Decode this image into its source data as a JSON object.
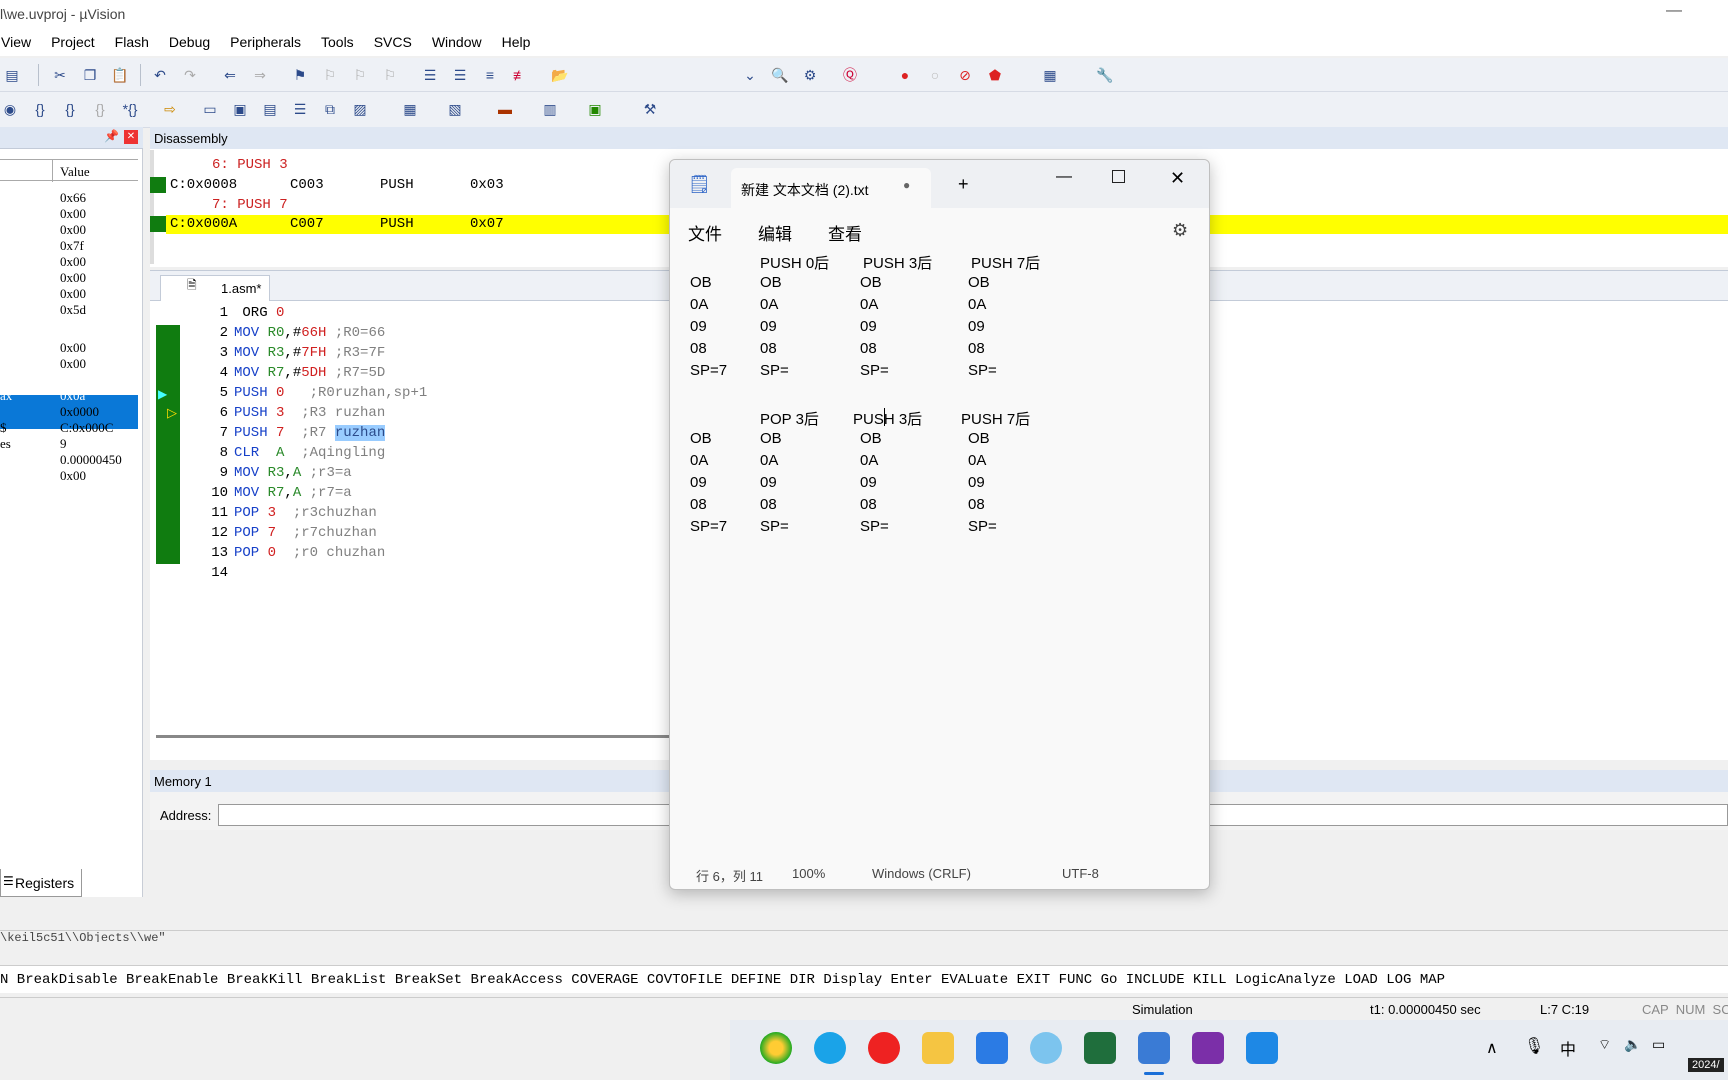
{
  "window": {
    "title": "l\\we.uvproj - µVision",
    "minimize_glyph": "—"
  },
  "menu": [
    "View",
    "Project",
    "Flash",
    "Debug",
    "Peripherals",
    "Tools",
    "SVCS",
    "Window",
    "Help"
  ],
  "registers": {
    "tab_label": "Registers",
    "value_header": "Value",
    "rows": [
      {
        "name": "",
        "value": "0x66"
      },
      {
        "name": "",
        "value": "0x00"
      },
      {
        "name": "",
        "value": "0x00"
      },
      {
        "name": "",
        "value": "0x7f"
      },
      {
        "name": "",
        "value": "0x00"
      },
      {
        "name": "",
        "value": "0x00"
      },
      {
        "name": "",
        "value": "0x00"
      },
      {
        "name": "",
        "value": "0x5d"
      },
      {
        "name": "",
        "value": "0x00"
      },
      {
        "name": "",
        "value": "0x00"
      },
      {
        "name": "",
        "value": "0x0a"
      },
      {
        "name": "ax",
        "value": "0x0a"
      },
      {
        "name": "",
        "value": "0x0000"
      },
      {
        "name": "$",
        "value": "C:0x000C"
      },
      {
        "name": "es",
        "value": "9"
      },
      {
        "name": "",
        "value": "0.00000450"
      },
      {
        "name": "",
        "value": "0x00"
      }
    ]
  },
  "disassembly": {
    "title": "Disassembly",
    "lines": [
      {
        "src": "     6: PUSH 3"
      },
      {
        "addr": "C:0x0008",
        "op": "C003",
        "mn": "PUSH",
        "arg": "0x03"
      },
      {
        "src": "     7: PUSH 7"
      },
      {
        "addr": "C:0x000A",
        "op": "C007",
        "mn": "PUSH",
        "arg": "0x07"
      }
    ]
  },
  "editor": {
    "tab": "1.asm*",
    "lines": [
      {
        "n": "1",
        "parts": [
          [
            "",
            " ORG "
          ],
          [
            "nm",
            "0"
          ]
        ]
      },
      {
        "n": "2",
        "parts": [
          [
            "kw",
            "MOV "
          ],
          [
            "rg",
            "R0"
          ],
          [
            "",
            ",#"
          ],
          [
            "nm",
            "66H"
          ],
          [
            "cm",
            " ;R0=66"
          ]
        ]
      },
      {
        "n": "3",
        "parts": [
          [
            "kw",
            "MOV "
          ],
          [
            "rg",
            "R3"
          ],
          [
            "",
            ",#"
          ],
          [
            "nm",
            "7FH"
          ],
          [
            "cm",
            " ;R3=7F"
          ]
        ]
      },
      {
        "n": "4",
        "parts": [
          [
            "kw",
            "MOV "
          ],
          [
            "rg",
            "R7"
          ],
          [
            "",
            ",#"
          ],
          [
            "nm",
            "5DH"
          ],
          [
            "cm",
            " ;R7=5D"
          ]
        ]
      },
      {
        "n": "5",
        "parts": [
          [
            "kw",
            "PUSH "
          ],
          [
            "nm",
            "0"
          ],
          [
            "cm",
            "   ;R0ruzhan,sp+1"
          ]
        ]
      },
      {
        "n": "6",
        "parts": [
          [
            "kw",
            "PUSH "
          ],
          [
            "nm",
            "3"
          ],
          [
            "cm",
            "  ;R3 ruzhan"
          ]
        ]
      },
      {
        "n": "7",
        "parts": [
          [
            "kw",
            "PUSH "
          ],
          [
            "nm",
            "7"
          ],
          [
            "cm",
            "  ;R7 "
          ],
          [
            "sel",
            "ruzhan"
          ]
        ]
      },
      {
        "n": "8",
        "parts": [
          [
            "kw",
            "CLR  "
          ],
          [
            "rg",
            "A"
          ],
          [
            "cm",
            "  ;Aqingling"
          ]
        ]
      },
      {
        "n": "9",
        "parts": [
          [
            "kw",
            "MOV "
          ],
          [
            "rg",
            "R3"
          ],
          [
            "",
            ","
          ],
          [
            "rg",
            "A"
          ],
          [
            "cm",
            " ;r3=a"
          ]
        ]
      },
      {
        "n": "10",
        "parts": [
          [
            "kw",
            "MOV "
          ],
          [
            "rg",
            "R7"
          ],
          [
            "",
            ","
          ],
          [
            "rg",
            "A"
          ],
          [
            "cm",
            " ;r7=a"
          ]
        ]
      },
      {
        "n": "11",
        "parts": [
          [
            "kw",
            "POP "
          ],
          [
            "nm",
            "3"
          ],
          [
            "cm",
            "  ;r3chuzhan"
          ]
        ]
      },
      {
        "n": "12",
        "parts": [
          [
            "kw",
            "POP "
          ],
          [
            "nm",
            "7"
          ],
          [
            "cm",
            "  ;r7chuzhan"
          ]
        ]
      },
      {
        "n": "13",
        "parts": [
          [
            "kw",
            "POP "
          ],
          [
            "nm",
            "0"
          ],
          [
            "cm",
            "  ;r0 chuzhan"
          ]
        ]
      },
      {
        "n": "14",
        "parts": []
      }
    ]
  },
  "memory": {
    "title": "Memory 1",
    "address_label": "Address:"
  },
  "notepad": {
    "tab_title": "新建 文本文档 (2).txt",
    "new_tab": "+",
    "menu": [
      "文件",
      "编辑",
      "查看"
    ],
    "block1": {
      "headers": [
        "",
        "PUSH 0后",
        "PUSH 3后",
        "PUSH 7后"
      ],
      "rows": [
        [
          "OB",
          "OB",
          "OB",
          "OB"
        ],
        [
          "0A",
          "0A",
          "0A",
          "0A"
        ],
        [
          "09",
          "09",
          "09",
          "09"
        ],
        [
          "08",
          "08",
          "08",
          "08"
        ],
        [
          "SP=7",
          "SP=",
          "SP=",
          "SP="
        ]
      ]
    },
    "block2": {
      "headers": [
        "",
        "POP 3后",
        "PUSH 3后",
        "PUSH 7后"
      ],
      "rows": [
        [
          "OB",
          "OB",
          "OB",
          "OB"
        ],
        [
          "0A",
          "0A",
          "0A",
          "0A"
        ],
        [
          "09",
          "09",
          "09",
          "09"
        ],
        [
          "08",
          "08",
          "08",
          "08"
        ],
        [
          "SP=7",
          "SP=",
          "SP=",
          "SP="
        ]
      ]
    },
    "status": {
      "position": "行 6，列 11",
      "zoom": "100%",
      "eol": "Windows (CRLF)",
      "encoding": "UTF-8"
    }
  },
  "output_path": "\\keil5c51\\\\Objects\\\\we\"",
  "command_bar": "N BreakDisable BreakEnable BreakKill BreakList BreakSet BreakAccess COVERAGE COVTOFILE DEFINE DIR Display Enter EVALuate EXIT FUNC Go INCLUDE KILL LogicAnalyze LOAD LOG MAP",
  "status_bar": {
    "mode": "Simulation",
    "time": "t1: 0.00000450 sec",
    "cursor": "L:7 C:19",
    "caps": "CAP  NUM  SC"
  },
  "taskbar": {
    "ime": "中",
    "clock": "2024/"
  },
  "colors": {
    "highlight_yellow": "#ffff00",
    "selection_blue": "#0a78d7",
    "gutter_green": "#107c10"
  }
}
